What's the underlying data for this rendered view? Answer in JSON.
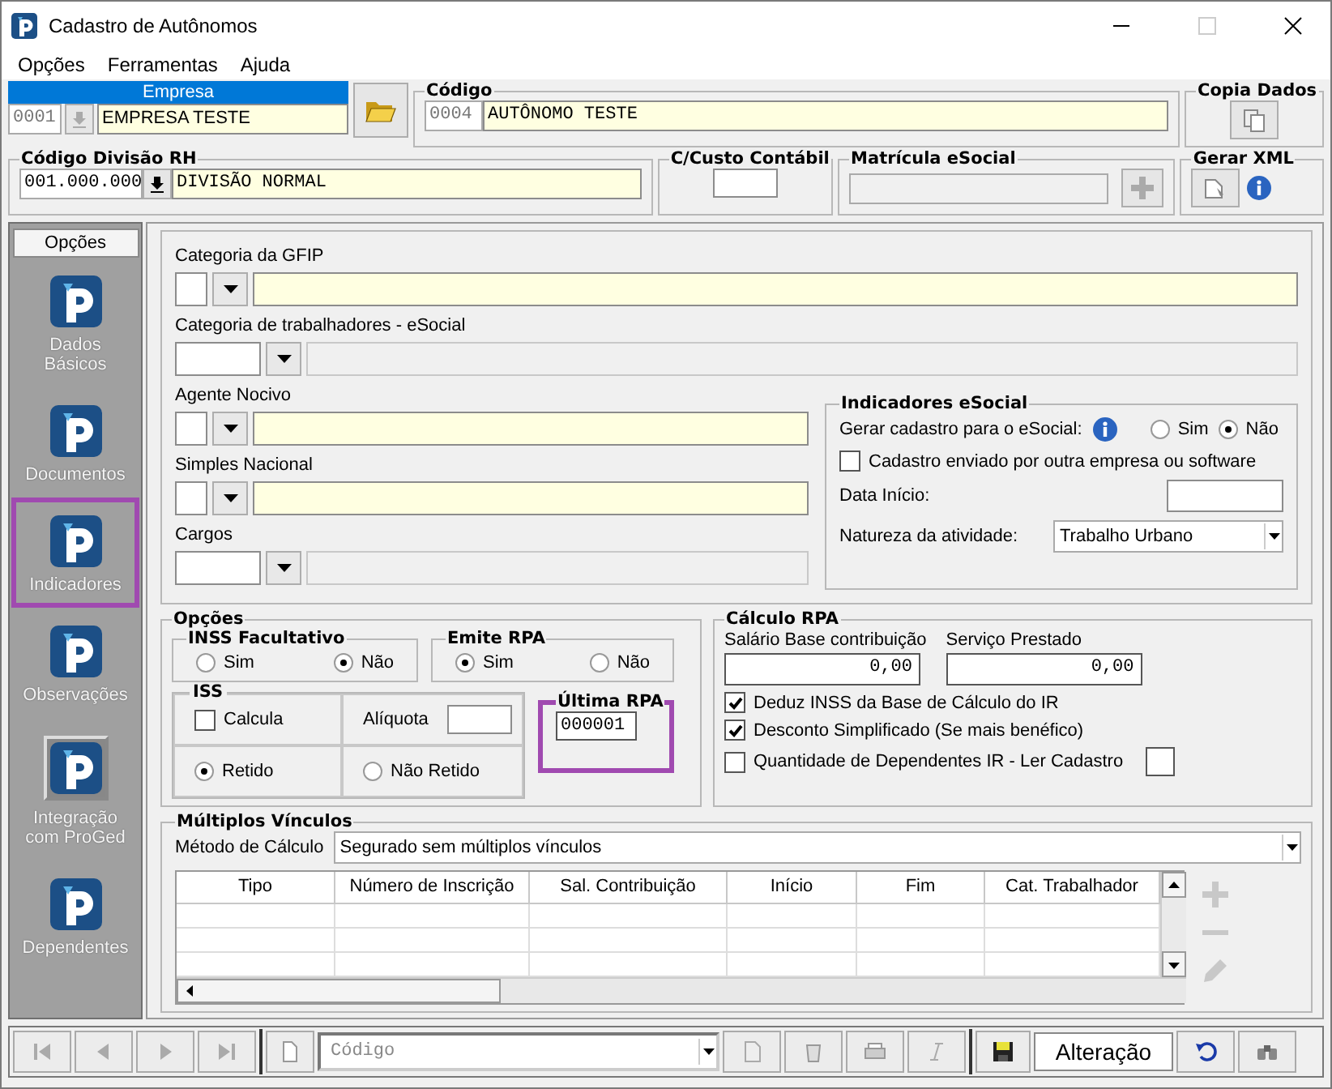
{
  "window": {
    "title": "Cadastro de Autônomos"
  },
  "menu": [
    "Opções",
    "Ferramentas",
    "Ajuda"
  ],
  "header": {
    "empresa": {
      "label": "Empresa",
      "code": "0001",
      "name": "EMPRESA TESTE"
    },
    "codigo": {
      "label": "Código",
      "code": "0004",
      "name": "AUTÔNOMO TESTE"
    },
    "copia_dados": {
      "label": "Copia Dados"
    },
    "divisao": {
      "label": "Código Divisão RH",
      "code": "001.000.000",
      "name": "DIVISÃO NORMAL"
    },
    "custo": {
      "label": "C/Custo Contábil"
    },
    "matricula": {
      "label": "Matrícula eSocial"
    },
    "gerar_xml": {
      "label": "Gerar XML"
    }
  },
  "sidebar": {
    "title": "Opções",
    "items": [
      {
        "label": "Dados Básicos",
        "selected": false,
        "pressed": false
      },
      {
        "label": "Documentos",
        "selected": false,
        "pressed": false
      },
      {
        "label": "Indicadores",
        "selected": true,
        "pressed": false
      },
      {
        "label": "Observações",
        "selected": false,
        "pressed": false
      },
      {
        "label": "Integração com ProGed",
        "selected": false,
        "pressed": true
      },
      {
        "label": "Dependentes",
        "selected": false,
        "pressed": false
      }
    ]
  },
  "fields": [
    {
      "label": "Categoria da GFIP",
      "kind": "short"
    },
    {
      "label": "Categoria de trabalhadores - eSocial",
      "kind": "wide"
    },
    {
      "label": "Agente  Nocivo",
      "kind": "short"
    },
    {
      "label": "Simples Nacional",
      "kind": "short"
    },
    {
      "label": "Cargos",
      "kind": "wide"
    }
  ],
  "indicadores_esocial": {
    "title": "Indicadores eSocial",
    "gerar_label": "Gerar cadastro para o eSocial:",
    "gerar_options": [
      {
        "label": "Sim",
        "selected": false
      },
      {
        "label": "Não",
        "selected": true
      }
    ],
    "enviado": {
      "label": "Cadastro enviado por outra empresa ou software",
      "checked": false
    },
    "data_inicio_label": "Data Início:",
    "natureza_label": "Natureza da atividade:",
    "natureza_value": "Trabalho Urbano"
  },
  "opcoes": {
    "title": "Opções",
    "inss": {
      "title": "INSS Facultativo",
      "options": [
        {
          "label": "Sim",
          "selected": false
        },
        {
          "label": "Não",
          "selected": true
        }
      ]
    },
    "emite_rpa": {
      "title": "Emite RPA",
      "options": [
        {
          "label": "Sim",
          "selected": true
        },
        {
          "label": "Não",
          "selected": false
        }
      ]
    },
    "iss": {
      "title": "ISS",
      "calcula": {
        "label": "Calcula",
        "checked": false
      },
      "aliquota_label": "Alíquota",
      "options": [
        {
          "label": "Retido",
          "selected": true
        },
        {
          "label": "Não Retido",
          "selected": false
        }
      ]
    },
    "ultima_rpa": {
      "title": "Última RPA",
      "value": "000001",
      "highlighted": true
    }
  },
  "calculo_rpa": {
    "title": "Cálculo RPA",
    "amounts": [
      {
        "label": "Salário Base contribuição",
        "value": "0,00"
      },
      {
        "label": "Serviço Prestado",
        "value": "0,00"
      }
    ],
    "checks": [
      {
        "label": "Deduz INSS da Base de Cálculo do IR",
        "checked": true
      },
      {
        "label": "Desconto Simplificado (Se mais benéfico)",
        "checked": true
      },
      {
        "label": "Quantidade de Dependentes IR - Ler Cadastro",
        "checked": false
      }
    ]
  },
  "multiplos_vinculos": {
    "title": "Múltiplos Vínculos",
    "metodo_label": "Método de Cálculo",
    "metodo_value": "Segurado sem múltiplos vínculos",
    "table": {
      "columns": [
        "Tipo",
        "Número de Inscrição",
        "Sal. Contribuição",
        "Início",
        "Fim",
        "Cat. Trabalhador"
      ]
    }
  },
  "toolbar": {
    "search_placeholder": "Código",
    "status": "Alteração"
  }
}
